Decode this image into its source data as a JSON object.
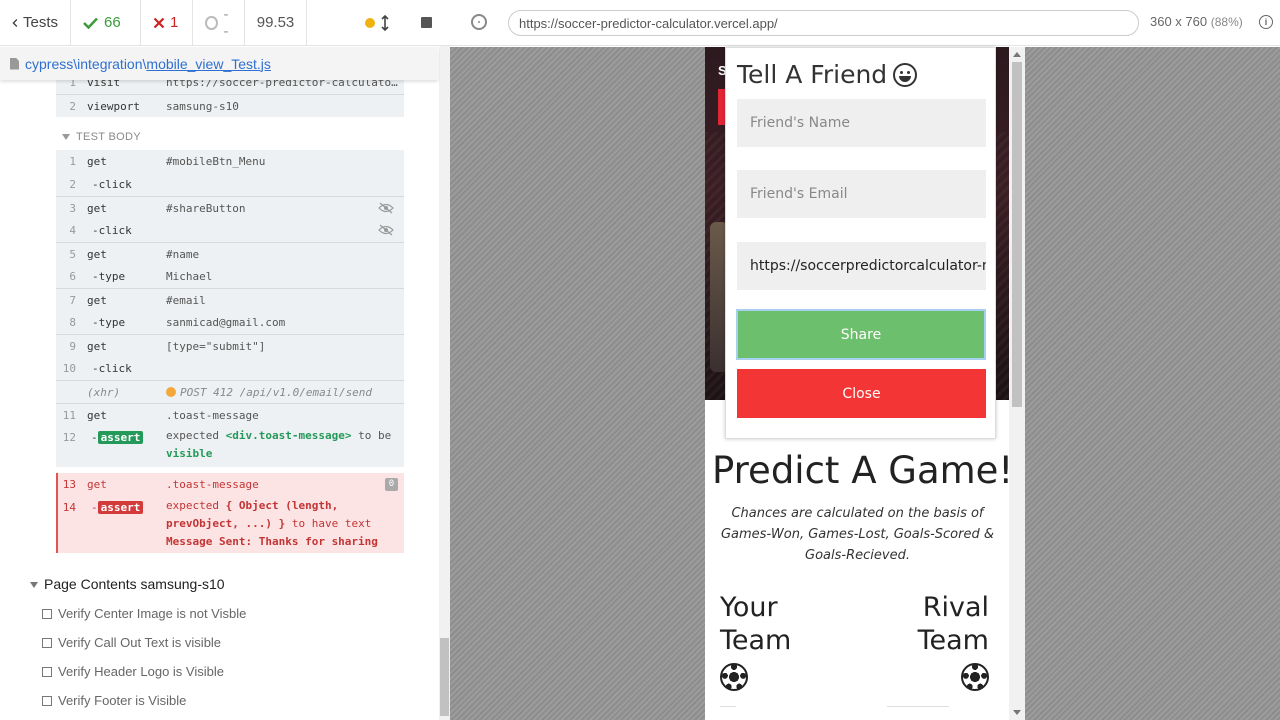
{
  "reporter": {
    "header": {
      "tests_label": "Tests",
      "passed": "66",
      "failed": "1",
      "pending": "--",
      "duration": "99.53"
    },
    "file": {
      "dir": "cypress\\integration\\",
      "name": "mobile_view_Test.js"
    },
    "before_commands": [
      {
        "n": "1",
        "cmd": "visit",
        "msg": "https://soccer-predictor-calculato…"
      },
      {
        "n": "2",
        "cmd": "viewport",
        "msg": "samsung-s10"
      }
    ],
    "test_body_label": "TEST BODY",
    "commands": [
      {
        "n": "1",
        "cmd": "get",
        "msg": "#mobileBtn_Menu"
      },
      {
        "n": "2",
        "cmd": "-click",
        "msg": ""
      },
      {
        "n": "3",
        "cmd": "get",
        "msg": "#shareButton"
      },
      {
        "n": "4",
        "cmd": "-click",
        "msg": ""
      },
      {
        "n": "5",
        "cmd": "get",
        "msg": "#name"
      },
      {
        "n": "6",
        "cmd": "-type",
        "msg": "Michael"
      },
      {
        "n": "7",
        "cmd": "get",
        "msg": "#email"
      },
      {
        "n": "8",
        "cmd": "-type",
        "msg": "sanmicad@gmail.com"
      },
      {
        "n": "9",
        "cmd": "get",
        "msg": "[type=\"submit\"]"
      },
      {
        "n": "10",
        "cmd": "-click",
        "msg": ""
      },
      {
        "n": "",
        "cmd": "(xhr)",
        "msg": "POST 412 /api/v1.0/email/send"
      },
      {
        "n": "11",
        "cmd": "get",
        "msg": ".toast-message"
      },
      {
        "n": "12",
        "cmd": "assert",
        "msg_a": "expected",
        "msg_b": "<div.toast-message>",
        "msg_c": "to be",
        "msg_d": "visible"
      },
      {
        "n": "13",
        "cmd": "get",
        "msg": ".toast-message",
        "badge": "0"
      },
      {
        "n": "14",
        "cmd": "assert",
        "msg_a": "expected",
        "msg_b": "{ Object (length,",
        "msg_c": "prevObject, ...) }",
        "msg_d": "to have text",
        "msg_e": "Message Sent: Thanks for sharing"
      }
    ],
    "suite": {
      "title": "Page Contents samsung-s10",
      "tests": [
        "Verify Center Image is not Visble",
        "Verify Call Out Text is visible",
        "Verify Header Logo is Visible",
        "Verify Footer is Visible"
      ]
    }
  },
  "aut": {
    "url": "https://soccer-predictor-calculator.vercel.app/",
    "viewport": "360 x 760",
    "scale": "(88%)",
    "modal": {
      "title": "Tell A Friend",
      "name_placeholder": "Friend's Name",
      "email_placeholder": "Friend's Email",
      "link_value": "https://soccerpredictorcalculator-m",
      "share_label": "Share",
      "close_label": "Close"
    },
    "page": {
      "title": "Predict A Game!",
      "subtitle": "Chances are calculated on the basis of Games-Won, Games-Lost, Goals-Scored & Goals-Recieved.",
      "your_team_line1": "Your",
      "your_team_line2": "Team",
      "rival_team_line1": "Rival",
      "rival_team_line2": "Team"
    }
  },
  "colors": {
    "pass": "#3a9c3a",
    "fail": "#cc2222",
    "share_green": "#6cbf6c",
    "close_red": "#f33535",
    "link_blue": "#2f6fd1"
  }
}
